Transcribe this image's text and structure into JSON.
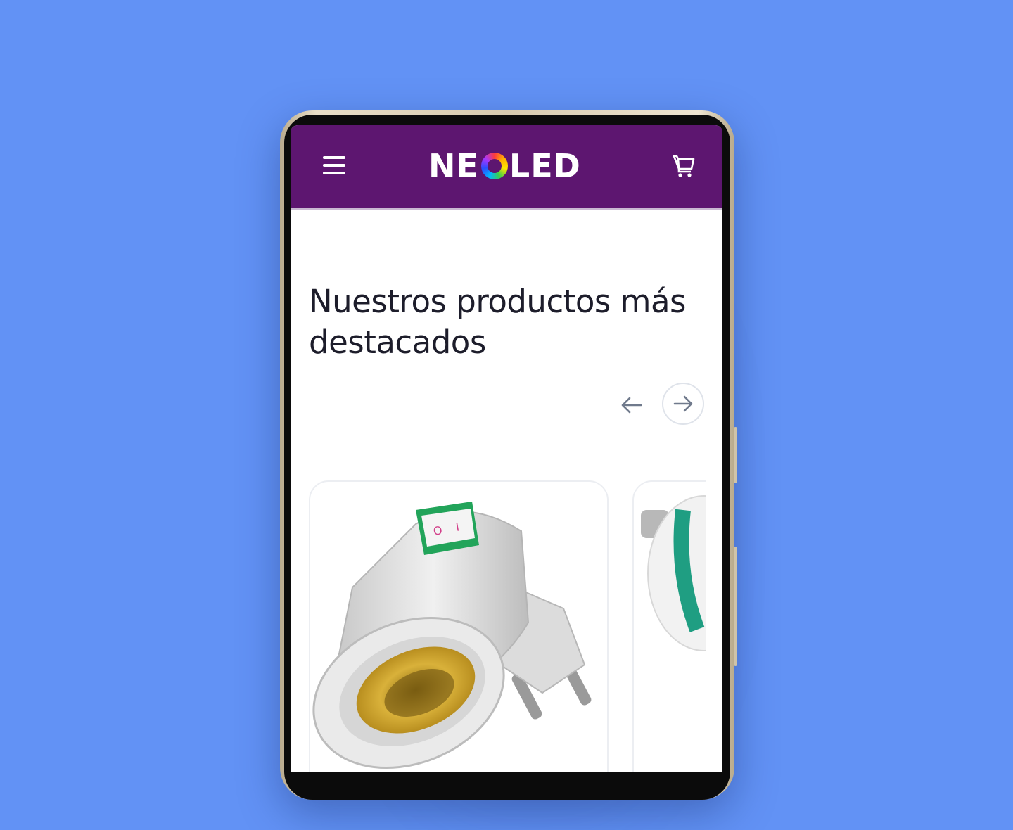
{
  "header": {
    "logo_text_left": "NE",
    "logo_text_right": "LED",
    "menu_icon": "hamburger-menu-icon",
    "cart_icon": "shopping-cart-icon",
    "background_color": "#5d1670"
  },
  "section": {
    "title": "Nuestros productos más destacados",
    "prev_icon": "arrow-left-icon",
    "next_icon": "arrow-right-icon"
  },
  "products": [
    {
      "image": "lamp-socket-plug-with-switch"
    },
    {
      "image": "led-bulb-partial"
    }
  ],
  "colors": {
    "page_background": "#6292f5",
    "header": "#5d1670",
    "title_text": "#1d1d2b"
  }
}
